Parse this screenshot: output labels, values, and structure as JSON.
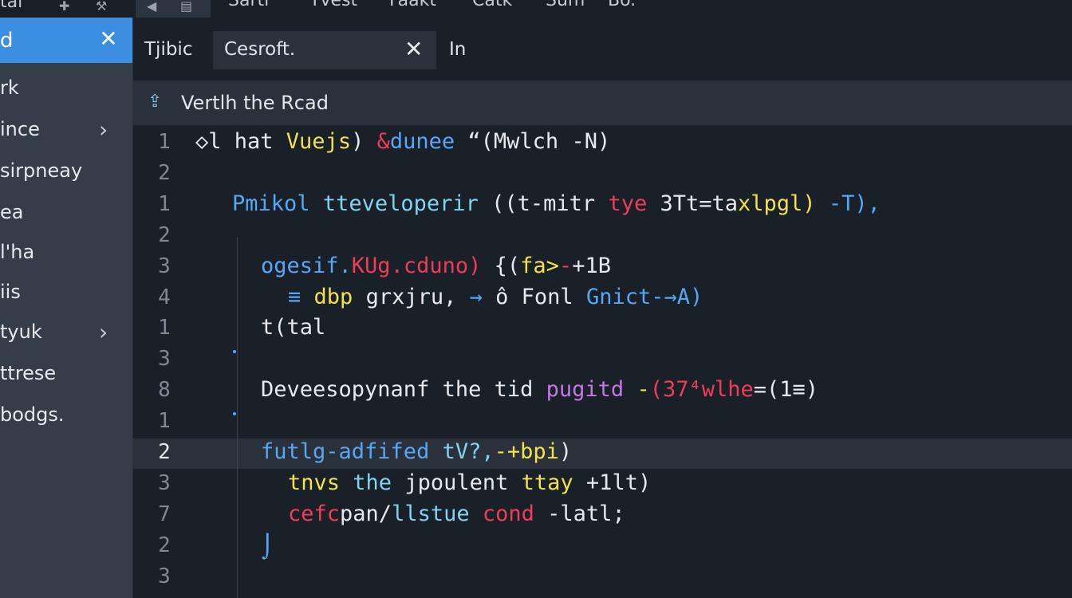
{
  "menubar": {
    "lead": "tal",
    "items": [
      "Sarti",
      "Tvest",
      "Faakt",
      "Catk",
      "Sum",
      "Bo."
    ]
  },
  "sidebar": {
    "header": {
      "title": "d"
    },
    "items": [
      {
        "label": "rk",
        "has_chevron": false
      },
      {
        "label": "ince",
        "has_chevron": true
      },
      {
        "label": "sirpneay",
        "has_chevron": false
      },
      {
        "label": "ea",
        "has_chevron": false
      },
      {
        "label": "l'ha",
        "has_chevron": false
      },
      {
        "label": "iis",
        "has_chevron": false
      },
      {
        "label": "tyuk",
        "has_chevron": true
      },
      {
        "label": "ttrese",
        "has_chevron": false
      },
      {
        "label": "bodgs.",
        "has_chevron": false
      }
    ]
  },
  "tabs": [
    {
      "label": "Tjibic",
      "active": false
    },
    {
      "label": "Cesroft.",
      "active": true
    },
    {
      "label": "In",
      "active": false
    }
  ],
  "breadcrumb": {
    "label": "Vertlh the Rcad"
  },
  "editor": {
    "active_line_index": 10,
    "line_numbers": [
      "1",
      "2",
      "1",
      "2",
      "3",
      "4",
      "1",
      "3",
      "8",
      "1",
      "2",
      "3",
      "7",
      "2",
      "3"
    ],
    "lines": [
      [
        [
          "w",
          "◇l hat "
        ],
        [
          "y",
          "Vuejs"
        ],
        [
          "w",
          ") "
        ],
        [
          "r",
          "&"
        ],
        [
          "b",
          "dunee"
        ],
        [
          "w",
          " “(Mwlch -N)"
        ]
      ],
      [],
      [
        [
          "b",
          "Pmikol"
        ],
        [
          "w",
          " "
        ],
        [
          "c",
          "tteveloperir"
        ],
        [
          "w",
          " ((t-mitr "
        ],
        [
          "r",
          "tye"
        ],
        [
          "w",
          " 3Tt=ta"
        ],
        [
          "y",
          "xlpgl)"
        ],
        [
          "w",
          " "
        ],
        [
          "b",
          "-T),"
        ]
      ],
      [],
      [
        [
          "b",
          "ogesif."
        ],
        [
          "r",
          "KUg.cduno)"
        ],
        [
          "w",
          " {("
        ],
        [
          "y",
          "fa>"
        ],
        [
          "r",
          "-"
        ],
        [
          "w",
          "+1B"
        ]
      ],
      [
        [
          "b",
          "≡"
        ],
        [
          "w",
          " "
        ],
        [
          "y",
          "dbp"
        ],
        [
          "w",
          " grxjru,"
        ],
        [
          "b",
          " → "
        ],
        [
          "w",
          "ô Fonl "
        ],
        [
          "b",
          "Gnict-→A)"
        ]
      ],
      [
        [
          "w",
          "t(tal"
        ]
      ],
      [],
      [
        [
          "w",
          "Deveesopynanf the tid "
        ],
        [
          "p",
          "pugitd"
        ],
        [
          "w",
          " "
        ],
        [
          "y",
          "-"
        ],
        [
          "r",
          "(37⁴wlhe"
        ],
        [
          "w",
          "=(1≡)"
        ]
      ],
      [],
      [
        [
          "b",
          "futlg-adfifed"
        ],
        [
          "w",
          " "
        ],
        [
          "c",
          "tV?,"
        ],
        [
          "y",
          "-+bpi"
        ],
        [
          "w",
          ")"
        ]
      ],
      [
        [
          "y",
          "tnvs"
        ],
        [
          "w",
          " "
        ],
        [
          "c",
          "the"
        ],
        [
          "w",
          " jpoulent "
        ],
        [
          "y",
          "ttay"
        ],
        [
          "w",
          " +1lt)"
        ]
      ],
      [
        [
          "r",
          "cefc"
        ],
        [
          "w",
          "pan/"
        ],
        [
          "c",
          "llstue"
        ],
        [
          "w",
          " "
        ],
        [
          "r",
          "cond"
        ],
        [
          "w",
          " -latl;"
        ]
      ],
      [],
      []
    ]
  }
}
